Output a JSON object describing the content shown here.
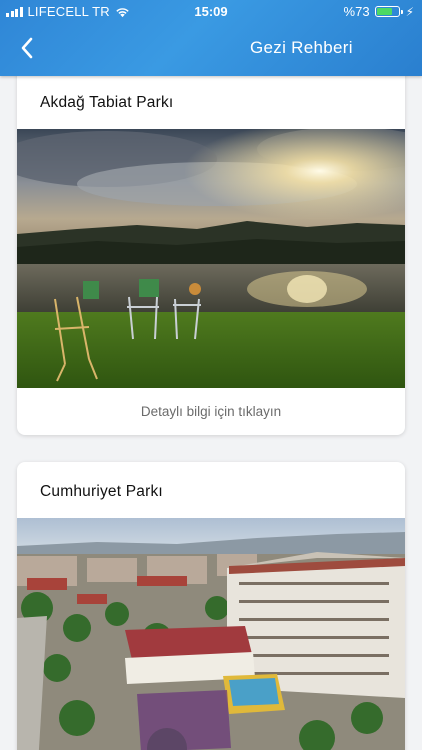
{
  "status_bar": {
    "carrier": "LIFECELL TR",
    "time": "15:09",
    "battery_percent": "%73",
    "battery_level": 0.73
  },
  "nav": {
    "title": "Gezi Rehberi",
    "back_icon": "chevron-left-icon"
  },
  "places": [
    {
      "title": "Akdağ Tabiat Parkı",
      "link_text": "Detaylı bilgi için tıklayın"
    },
    {
      "title": "Cumhuriyet Parkı"
    }
  ],
  "colors": {
    "header": "#2f86d6",
    "battery_fill": "#4cd964",
    "background": "#f2f3f5"
  }
}
